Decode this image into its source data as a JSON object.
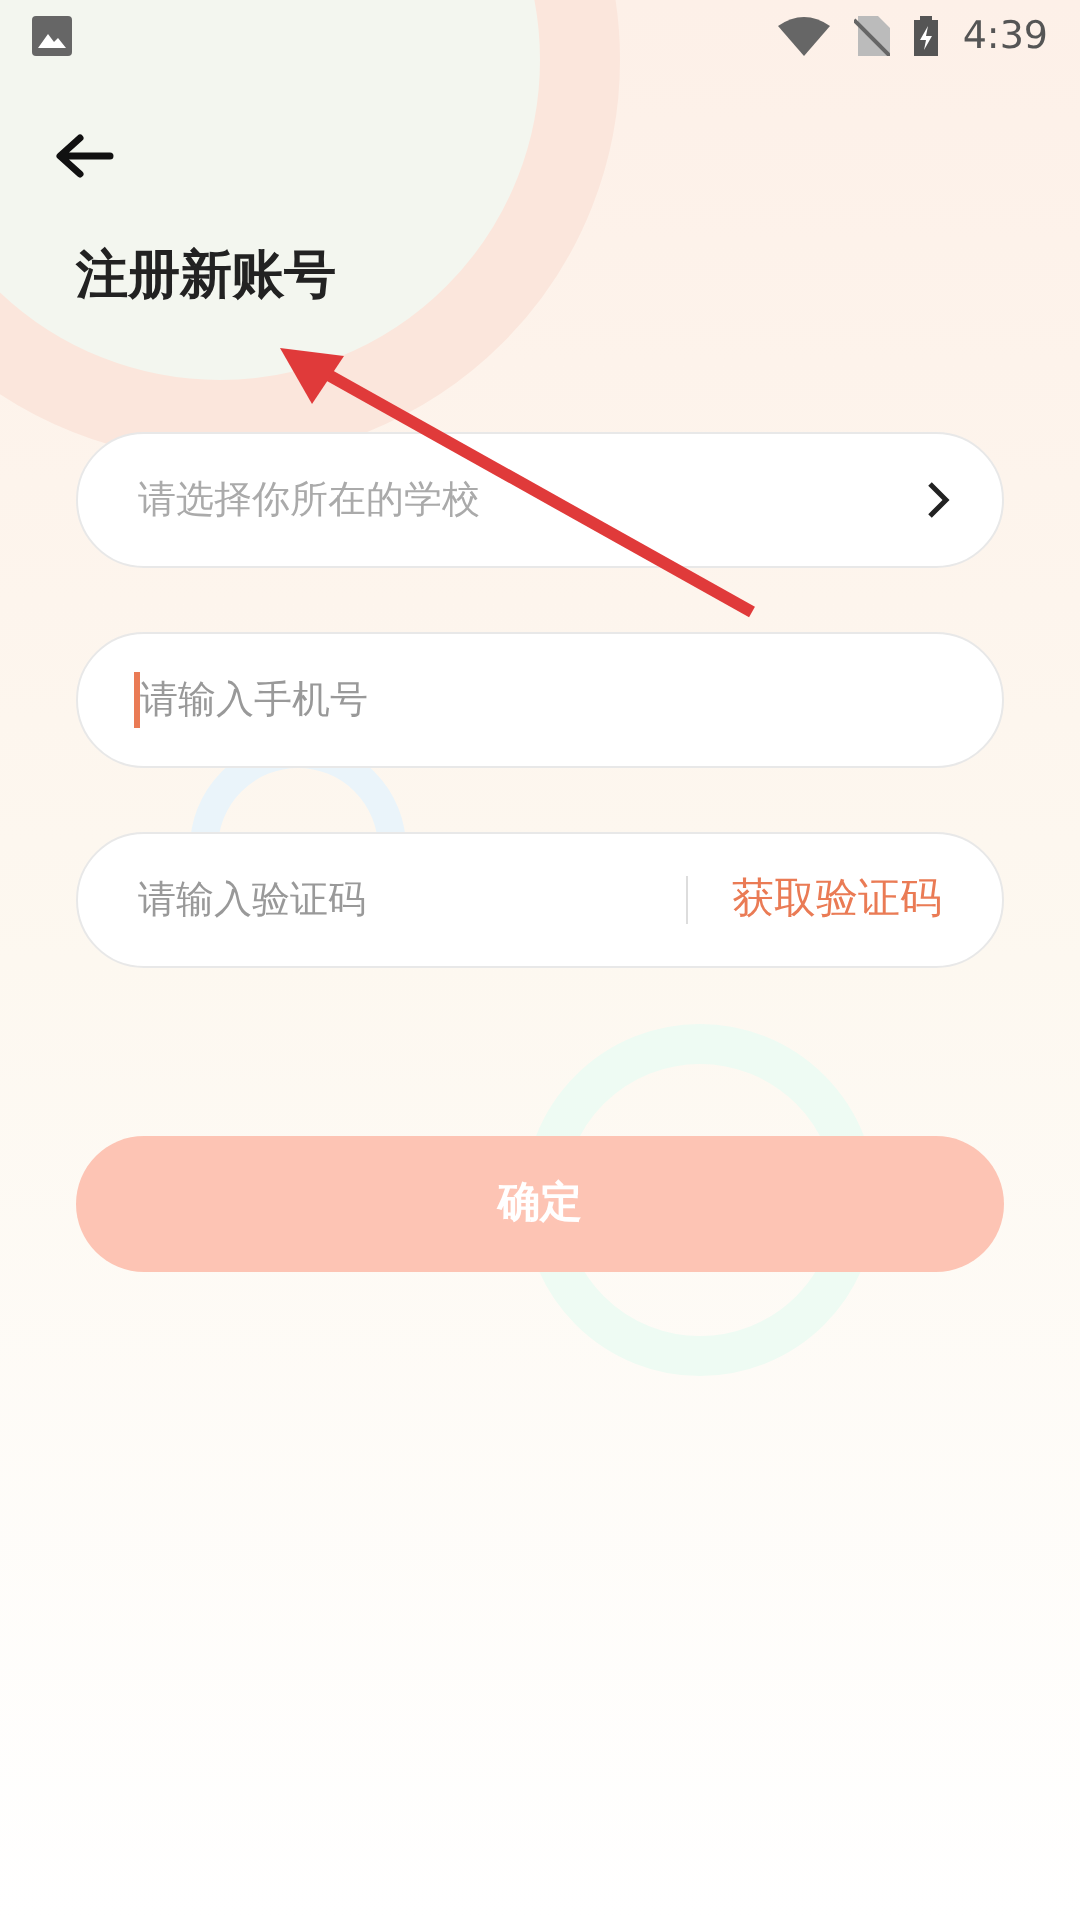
{
  "status_bar": {
    "time": "4:39"
  },
  "title": "注册新账号",
  "school_field": {
    "placeholder": "请选择你所在的学校"
  },
  "phone_field": {
    "placeholder": "请输入手机号",
    "focused": true
  },
  "code_field": {
    "placeholder": "请输入验证码",
    "action": "获取验证码"
  },
  "confirm_button": {
    "label": "确定",
    "disabled": true
  }
}
